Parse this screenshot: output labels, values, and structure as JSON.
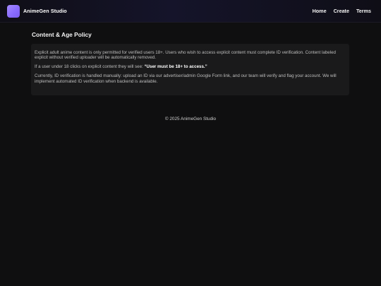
{
  "header": {
    "brand": "AnimeGen Studio",
    "nav": [
      "Home",
      "Create",
      "Terms"
    ]
  },
  "main": {
    "title": "Content & Age Policy",
    "paragraphs": {
      "p1": "Explicit adult anime content is only permitted for verified users 18+. Users who wish to access explicit content must complete ID verification. Content labeled explicit without verified uploader will be automatically removed.",
      "p2_prefix": "If a user under 18 clicks on explicit content they will see: ",
      "p2_quote": "“User must be 18+ to access.”",
      "p3": "Currently, ID verification is handled manually: upload an ID via our advertiser/admin Google Form link, and our team will verify and flag your account. We will implement automated ID verification when backend is available."
    }
  },
  "footer": {
    "text": "© 2025 AnimeGen Studio"
  },
  "colors": {
    "background": "#0f0f10",
    "card": "#1a1a1b",
    "accent": "#8a6cff"
  }
}
